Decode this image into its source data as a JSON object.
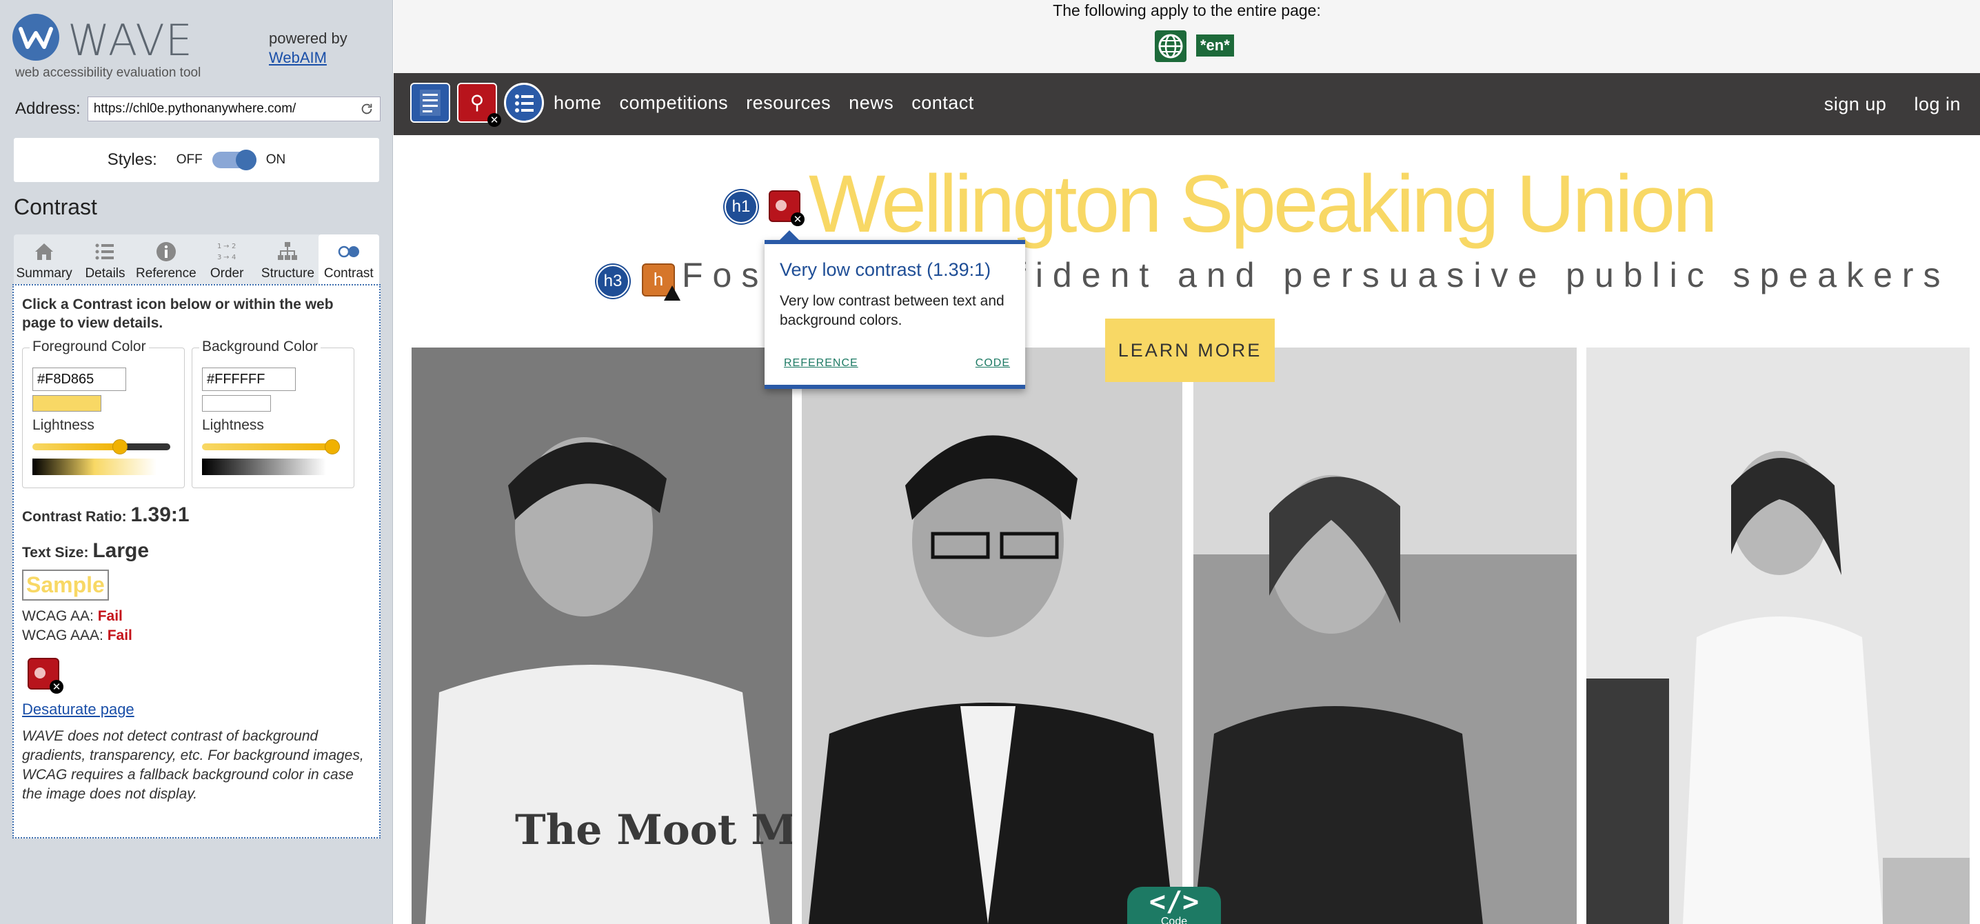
{
  "wave": {
    "title": "WAVE",
    "tagline": "web accessibility evaluation tool",
    "powered_by": "powered by",
    "webaim_link": "WebAIM",
    "address_label": "Address:",
    "address_value": "https://chl0e.pythonanywhere.com/",
    "styles_label": "Styles:",
    "styles_off": "OFF",
    "styles_on": "ON",
    "styles_enabled": true,
    "panel_title": "Contrast",
    "tabs": [
      {
        "label": "Summary",
        "icon": "home-icon"
      },
      {
        "label": "Details",
        "icon": "list-icon"
      },
      {
        "label": "Reference",
        "icon": "info-icon"
      },
      {
        "label": "Order",
        "icon": "order-icon"
      },
      {
        "label": "Structure",
        "icon": "structure-icon"
      },
      {
        "label": "Contrast",
        "icon": "contrast-icon"
      }
    ],
    "active_tab": "Contrast",
    "contrast": {
      "instructions": "Click a Contrast icon below or within the web page to view details.",
      "foreground_legend": "Foreground Color",
      "background_legend": "Background Color",
      "foreground_hex": "#F8D865",
      "background_hex": "#FFFFFF",
      "lightness_label": "Lightness",
      "foreground_lightness": 0.65,
      "background_lightness": 1.0,
      "ratio_label": "Contrast Ratio:",
      "ratio_value": "1.39:1",
      "textsize_label": "Text Size:",
      "textsize_value": "Large",
      "sample_text": "Sample",
      "wcag_aa_label": "WCAG AA:",
      "wcag_aa_result": "Fail",
      "wcag_aaa_label": "WCAG AAA:",
      "wcag_aaa_result": "Fail",
      "desaturate_link": "Desaturate page",
      "disclaimer": "WAVE does not detect contrast of background gradients, transparency, etc. For background images, WCAG requires a fallback background color in case the image does not display."
    }
  },
  "page": {
    "banner_text": "The following apply to the entire page:",
    "lang_badge": "*en*",
    "nav": {
      "links": [
        "home",
        "competitions",
        "resources",
        "news",
        "contact"
      ],
      "right": [
        "sign up",
        "log in"
      ]
    },
    "h1_badge": "h1",
    "h3_badge": "h3",
    "site_title": "Wellington Speaking Union",
    "subtitle": "Fostering confident and persuasive public speakers",
    "learn_more": "LEARN MORE",
    "photo_text": "The Moot Must Fall.",
    "code_tab_label": "Code",
    "colors": {
      "title_yellow": "#F8D865",
      "nav_bg": "#3D3B3B",
      "wave_blue": "#2A5AA7",
      "error_red": "#B8141C"
    }
  },
  "tooltip": {
    "title": "Very low contrast (1.39:1)",
    "description": "Very low contrast between text and background colors.",
    "reference_link": "REFERENCE",
    "code_link": "CODE"
  }
}
